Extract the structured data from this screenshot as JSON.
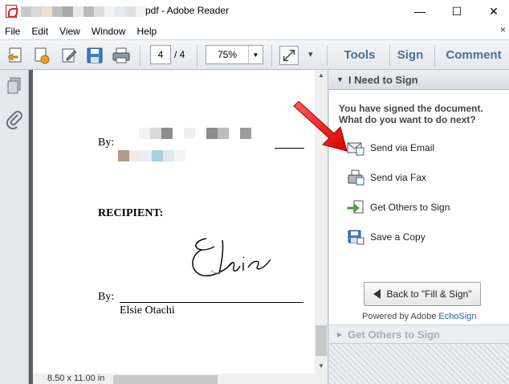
{
  "window": {
    "title": "pdf - Adobe Reader",
    "blur_colors": [
      "#c9c9c9",
      "#d9d9d9",
      "#efe1cf",
      "#bfbfbf",
      "#a8a8a8",
      "#e8e8e8",
      "#b9b9b9",
      "#dcdcdc",
      "#f2f2f2",
      "#e5eaf1",
      "#e1e1e1",
      "#f2f2f2"
    ],
    "minimize": "—",
    "maximize": "☐",
    "close": "✕"
  },
  "menu": {
    "items": [
      "File",
      "Edit",
      "View",
      "Window",
      "Help"
    ],
    "close_glyph": "×"
  },
  "toolbar": {
    "page_current": "4",
    "page_total": "/ 4",
    "zoom": "75%",
    "zoom_arrow": "▼",
    "more_glyph": "▾",
    "tabs": [
      "Tools",
      "Sign",
      "Comment"
    ]
  },
  "document": {
    "by_label_1": "By:",
    "recipient_label": "RECIPIENT:",
    "by_label_2": "By:",
    "signer_name": "Elsie Otachi",
    "signature_text": "Elsie",
    "page_size": "8.50 x 11.00 in",
    "blur_row_1": [
      "#f4f4f4",
      "#d9d9d9",
      "#8c8c8c",
      "#ffffff",
      "#efefef",
      "#ffffff",
      "#8c8c8c",
      "#bdbdbd",
      "#ffffff",
      "#9c9c9c"
    ],
    "blur_row_2": [
      "#b29a8a",
      "#f2e9e4",
      "#e9eff3",
      "#a9d0dd",
      "#dce9ee",
      "#f4f4f4"
    ]
  },
  "sign_panel": {
    "header": "I Need to Sign",
    "message_line1": "You have signed the document.",
    "message_line2": "What do you want to do next?",
    "actions": [
      {
        "label": "Send via Email",
        "icon": "email-icon"
      },
      {
        "label": "Send via Fax",
        "icon": "fax-icon"
      },
      {
        "label": "Get Others to Sign",
        "icon": "send-for-signature-icon"
      },
      {
        "label": "Save a Copy",
        "icon": "save-icon"
      }
    ],
    "back_button": "Back to \"Fill & Sign\"",
    "powered_by": "Powered by Adobe",
    "brand": "EchoSign",
    "collapsed_header": "Get Others to Sign"
  }
}
